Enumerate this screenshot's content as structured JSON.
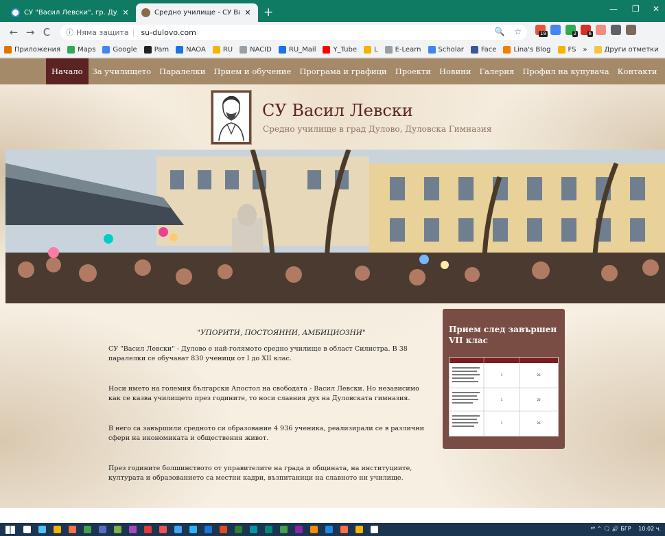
{
  "browser": {
    "tabs": [
      {
        "label": "СУ \"Васил Левски\", гр. Дулово -",
        "active": false
      },
      {
        "label": "Средно училище - СУ Васил Лев",
        "active": true
      }
    ],
    "new_tab_symbol": "+",
    "tab_close_symbol": "✕",
    "window_controls": {
      "minimize": "—",
      "maximize": "❐",
      "close": "✕"
    },
    "nav": {
      "back": "←",
      "forward": "→",
      "reload": "C"
    },
    "omnibox": {
      "security_text": "Няма защита",
      "url": "su-dulovo.com",
      "info_icon": "ⓘ",
      "zoom_icon": "🔍",
      "star_icon": "☆"
    },
    "extensions": [
      {
        "name": "ext-1",
        "color": "#e5533c",
        "badge": "19"
      },
      {
        "name": "ext-2",
        "color": "#4285f4",
        "badge": ""
      },
      {
        "name": "ext-3",
        "color": "#34a853",
        "badge": "2"
      },
      {
        "name": "ext-gmail",
        "color": "#d93025",
        "badge": "6"
      },
      {
        "name": "ext-5",
        "color": "#f28b82",
        "badge": ""
      },
      {
        "name": "ext-6",
        "color": "#5f6368",
        "badge": ""
      },
      {
        "name": "ext-avatar",
        "color": "#7a6a5a",
        "badge": ""
      }
    ],
    "bookmarks": [
      {
        "label": "Приложения",
        "color": "#e37400"
      },
      {
        "label": "Maps",
        "color": "#34a853"
      },
      {
        "label": "Google",
        "color": "#4285f4"
      },
      {
        "label": "Pam",
        "color": "#222"
      },
      {
        "label": "NAOA",
        "color": "#1a73e8"
      },
      {
        "label": "RU",
        "color": "#f4b400"
      },
      {
        "label": "NACID",
        "color": "#9aa0a6"
      },
      {
        "label": "RU_Mail",
        "color": "#1a73e8"
      },
      {
        "label": "Y_Tube",
        "color": "#ff0000"
      },
      {
        "label": "L",
        "color": "#f4b400"
      },
      {
        "label": "E-Learn",
        "color": "#9aa0a6"
      },
      {
        "label": "Scholar",
        "color": "#4285f4"
      },
      {
        "label": "Face",
        "color": "#3b5998"
      },
      {
        "label": "Lina's Blog",
        "color": "#f57d00"
      },
      {
        "label": "FS",
        "color": "#f4b400"
      }
    ],
    "bookmarks_more": "»",
    "other_bookmarks": "Други отметки"
  },
  "site": {
    "nav": [
      {
        "label": "Начало",
        "active": true
      },
      {
        "label": "За училището",
        "active": false
      },
      {
        "label": "Паралелки",
        "active": false
      },
      {
        "label": "Прием и обучение",
        "active": false
      },
      {
        "label": "Програма и графици",
        "active": false
      },
      {
        "label": "Проекти",
        "active": false
      },
      {
        "label": "Новини",
        "active": false
      },
      {
        "label": "Галерия",
        "active": false
      },
      {
        "label": "Профил на купувача",
        "active": false
      },
      {
        "label": "Контакти",
        "active": false
      }
    ],
    "title": "СУ Васил Левски",
    "subtitle": "Средно училище в град Дулово, Дуловска Гимназия",
    "motto": "\"УПОРИТИ, ПОСТОЯННИ, АМБИЦИОЗНИ\"",
    "paragraphs": [
      "СУ \"Васил Левски\" - Дулово е най-голямото средно училище в област Силистра. В 38 паралелки се обучават 830 ученици от I до XII клас.",
      "Носи името на големия български Апостол на свободата - Васил Левски. Но независимо как се казва училището през годините, то носи славния дух на Дуловската гимназия.",
      "В него са завършили средното си образование 4 936 ученика, реализирали се в различни сфери на икономиката и обществения живот.",
      "През годините болшинството от управителите на града и общината, на институциите, културата и образованието са местни кадри, възпитаници на славното ни училище."
    ],
    "sidebar": {
      "title": "Прием след завършен VII клас",
      "table_rows": [
        {
          "value": "1",
          "count": "26"
        },
        {
          "value": "1",
          "count": "26"
        },
        {
          "value": "1",
          "count": "26"
        }
      ]
    }
  },
  "taskbar": {
    "apps": [
      "#ffffff",
      "#4fc3f7",
      "#f4b400",
      "#ff7043",
      "#43a047",
      "#5c6bc0",
      "#7cb342",
      "#ab47bc",
      "#e53935",
      "#ef5350",
      "#42a5f5",
      "#29b6f6",
      "#1976d2",
      "#e64a19",
      "#2e7d32",
      "#0097a7",
      "#00897b",
      "#43a047",
      "#8e24aa",
      "#fb8c00",
      "#1e88e5",
      "#ff7043",
      "#ffb300",
      "#ffffff"
    ],
    "tray_text": "ᵠᴿ ⌃ 🗨 🔊 БГР",
    "time": "10:02 ч."
  },
  "colors": {
    "chrome_frame": "#0f7b62",
    "site_nav": "#a48a69",
    "site_nav_active": "#5c2323",
    "title": "#5c2323",
    "sidebar_panel": "#7a4d44"
  }
}
